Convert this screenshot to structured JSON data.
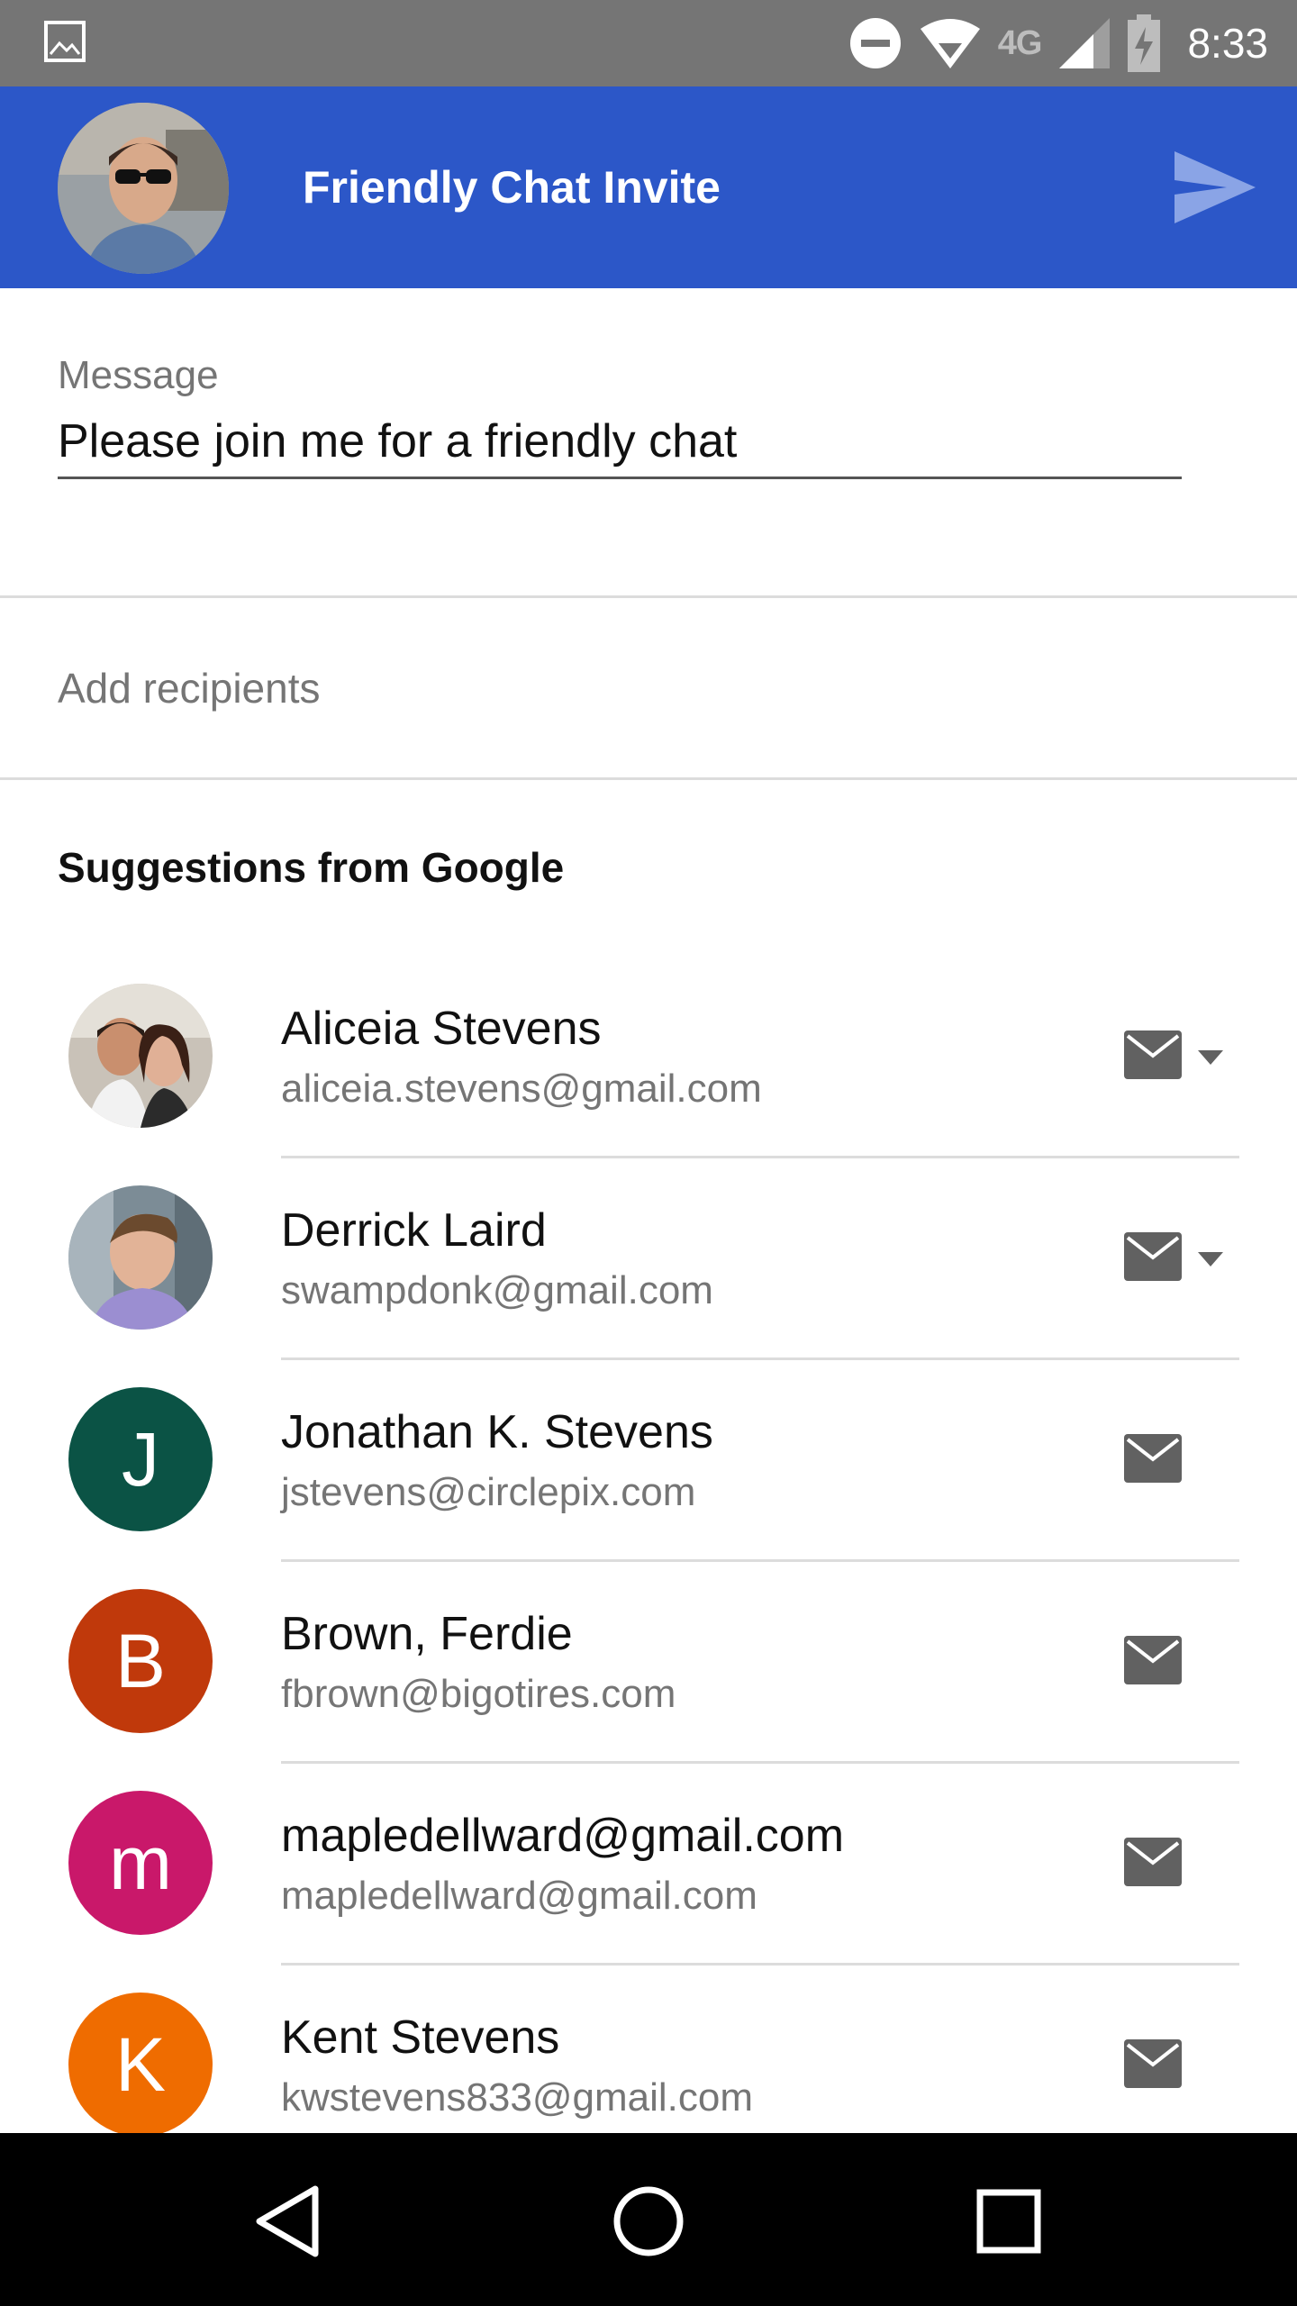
{
  "status_bar": {
    "time": "8:33",
    "network_label": "4G",
    "icons": [
      "image-icon",
      "do-not-disturb-icon",
      "wifi-icon",
      "signal-icon",
      "battery-charging-icon"
    ]
  },
  "app_bar": {
    "title": "Friendly Chat Invite",
    "send_icon": "send-icon",
    "background": "#2c57c8"
  },
  "message": {
    "label": "Message",
    "value": "Please join me for a friendly chat"
  },
  "recipients": {
    "placeholder": "Add recipients"
  },
  "suggestions": {
    "header": "Suggestions from Google",
    "contacts": [
      {
        "name": "Aliceia Stevens",
        "email": "aliceia.stevens@gmail.com",
        "avatar_type": "photo",
        "has_dropdown": true
      },
      {
        "name": "Derrick Laird",
        "email": "swampdonk@gmail.com",
        "avatar_type": "photo",
        "has_dropdown": true
      },
      {
        "name": "Jonathan K. Stevens",
        "email": "jstevens@circlepix.com",
        "avatar_type": "letter",
        "letter": "J",
        "color": "#0b5345",
        "has_dropdown": false
      },
      {
        "name": "Brown, Ferdie",
        "email": "fbrown@bigotires.com",
        "avatar_type": "letter",
        "letter": "B",
        "color": "#c0390b",
        "has_dropdown": false
      },
      {
        "name": "mapledellward@gmail.com",
        "email": "mapledellward@gmail.com",
        "avatar_type": "letter",
        "letter": "m",
        "color": "#c9186a",
        "has_dropdown": false
      },
      {
        "name": "Kent Stevens",
        "email": "kwstevens833@gmail.com",
        "avatar_type": "letter",
        "letter": "K",
        "color": "#ef6c00",
        "has_dropdown": false
      }
    ]
  },
  "nav_bar": {
    "buttons": [
      "back-icon",
      "home-icon",
      "recents-icon"
    ]
  }
}
